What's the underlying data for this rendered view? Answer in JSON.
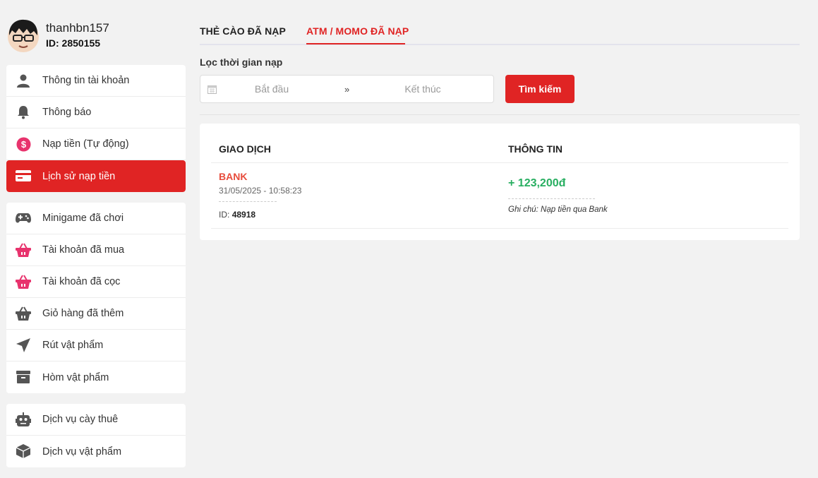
{
  "profile": {
    "username": "thanhbn157",
    "id_label": "ID: 2850155"
  },
  "menu_groups": [
    [
      {
        "label": "Thông tin tài khoản",
        "icon": "user-icon"
      },
      {
        "label": "Thông báo",
        "icon": "bell-icon"
      },
      {
        "label": "Nạp tiền (Tự động)",
        "icon": "dollar-circle-icon"
      },
      {
        "label": "Lịch sử nạp tiền",
        "icon": "credit-card-icon",
        "active": true
      }
    ],
    [
      {
        "label": "Minigame đã chơi",
        "icon": "gamepad-icon"
      },
      {
        "label": "Tài khoản đã mua",
        "icon": "basket-icon"
      },
      {
        "label": "Tài khoản đã cọc",
        "icon": "basket-icon"
      },
      {
        "label": "Giỏ hàng đã thêm",
        "icon": "basket-icon"
      },
      {
        "label": "Rút vật phẩm",
        "icon": "send-icon"
      },
      {
        "label": "Hòm vật phẩm",
        "icon": "archive-icon"
      }
    ],
    [
      {
        "label": "Dịch vụ cày thuê",
        "icon": "robot-icon"
      },
      {
        "label": "Dịch vụ vật phẩm",
        "icon": "box-icon"
      }
    ]
  ],
  "tabs": [
    {
      "label": "THẺ CÀO ĐÃ NẠP",
      "active": false
    },
    {
      "label": "ATM / MOMO ĐÃ NẠP",
      "active": true
    }
  ],
  "filter": {
    "label": "Lọc thời gian nạp",
    "start_placeholder": "Bắt đầu",
    "separator": "»",
    "end_placeholder": "Kết thúc",
    "search_label": "Tìm kiếm"
  },
  "table": {
    "headers": [
      "GIAO DỊCH",
      "THÔNG TIN"
    ],
    "rows": [
      {
        "type": "BANK",
        "datetime": "31/05/2025 - 10:58:23",
        "id_prefix": "ID:",
        "id_value": "48918",
        "amount": "+ 123,200đ",
        "note": "Ghi chú: Nạp tiền qua Bank"
      }
    ]
  },
  "colors": {
    "accent": "#e02424",
    "amount": "#27ae60",
    "bank": "#e74c3c",
    "icon_gray": "#555555",
    "icon_pink": "#e8336d"
  }
}
